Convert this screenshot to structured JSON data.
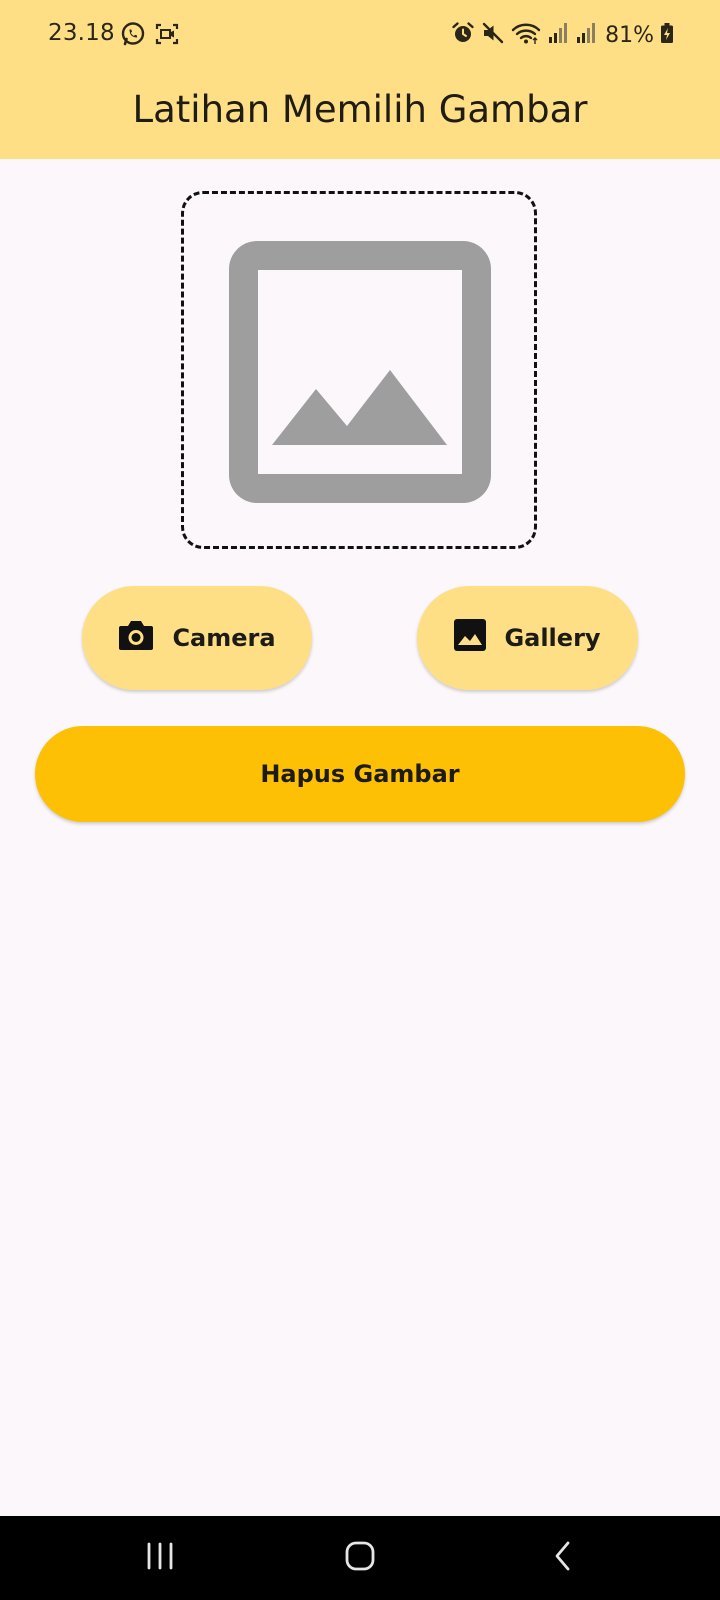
{
  "status_bar": {
    "time": "23.18",
    "battery": "81%",
    "left_icons": [
      "whatsapp-icon",
      "screen-record-icon"
    ],
    "right_icons": [
      "alarm-icon",
      "mute-icon",
      "wifi-icon",
      "signal-icon",
      "signal-icon",
      "battery-charging-icon"
    ]
  },
  "app_bar": {
    "title": "Latihan Memilih Gambar"
  },
  "image_preview": {
    "icon": "image-placeholder-icon"
  },
  "buttons": {
    "camera_label": "Camera",
    "camera_icon": "camera-icon",
    "gallery_label": "Gallery",
    "gallery_icon": "image-icon",
    "delete_label": "Hapus Gambar"
  },
  "navigation_bar": {
    "buttons": [
      "recent-apps-icon",
      "home-icon",
      "back-icon"
    ]
  },
  "colors": {
    "app_bar": "#ffdf86",
    "tonal_button": "#ffdf86",
    "delete_button": "#fdc004",
    "background": "#fbf7fb",
    "placeholder": "#9e9e9e"
  }
}
